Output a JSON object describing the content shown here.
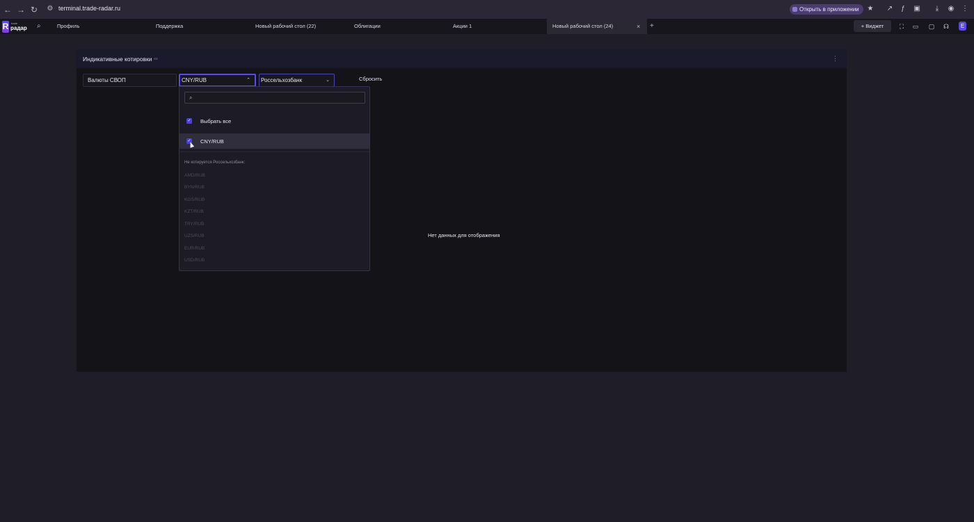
{
  "browser": {
    "url": "terminal.trade-radar.ru",
    "open_in_app": "Открыть в приложении"
  },
  "app": {
    "logo_text": "радар",
    "logo_small": "trade",
    "tabs": [
      {
        "label": "Профиль"
      },
      {
        "label": "Поддержка"
      },
      {
        "label": "Новый рабочий стол (22)"
      },
      {
        "label": "Облигации"
      },
      {
        "label": "Акции 1"
      },
      {
        "label": "Новый рабочий стол (24)"
      }
    ],
    "widget_button": "+ Виджет",
    "user_initial": "E"
  },
  "widget": {
    "title": "Индикативные котировки",
    "filters": {
      "type_value": "Валюты СВОП",
      "pair_value": "CNY/RUB",
      "bank_value": "Россельхозбанк",
      "reset_label": "Сбросить"
    },
    "empty_message": "Нет данных для отображения"
  },
  "dropdown": {
    "search_placeholder": "",
    "select_all_label": "Выбрать все",
    "selected_items": [
      "CNY/RUB"
    ],
    "unavailable_note": "Не котируется Россельхозбанк:",
    "unavailable_items": [
      "AMD/RUB",
      "BYN/RUB",
      "KGS/RUB",
      "KZT/RUB",
      "TRY/RUB",
      "UZS/RUB",
      "EUR/RUB",
      "USD/RUB"
    ]
  },
  "colors": {
    "accent": "#5a49f0",
    "background": "#1f1d28",
    "panel": "#141317"
  }
}
